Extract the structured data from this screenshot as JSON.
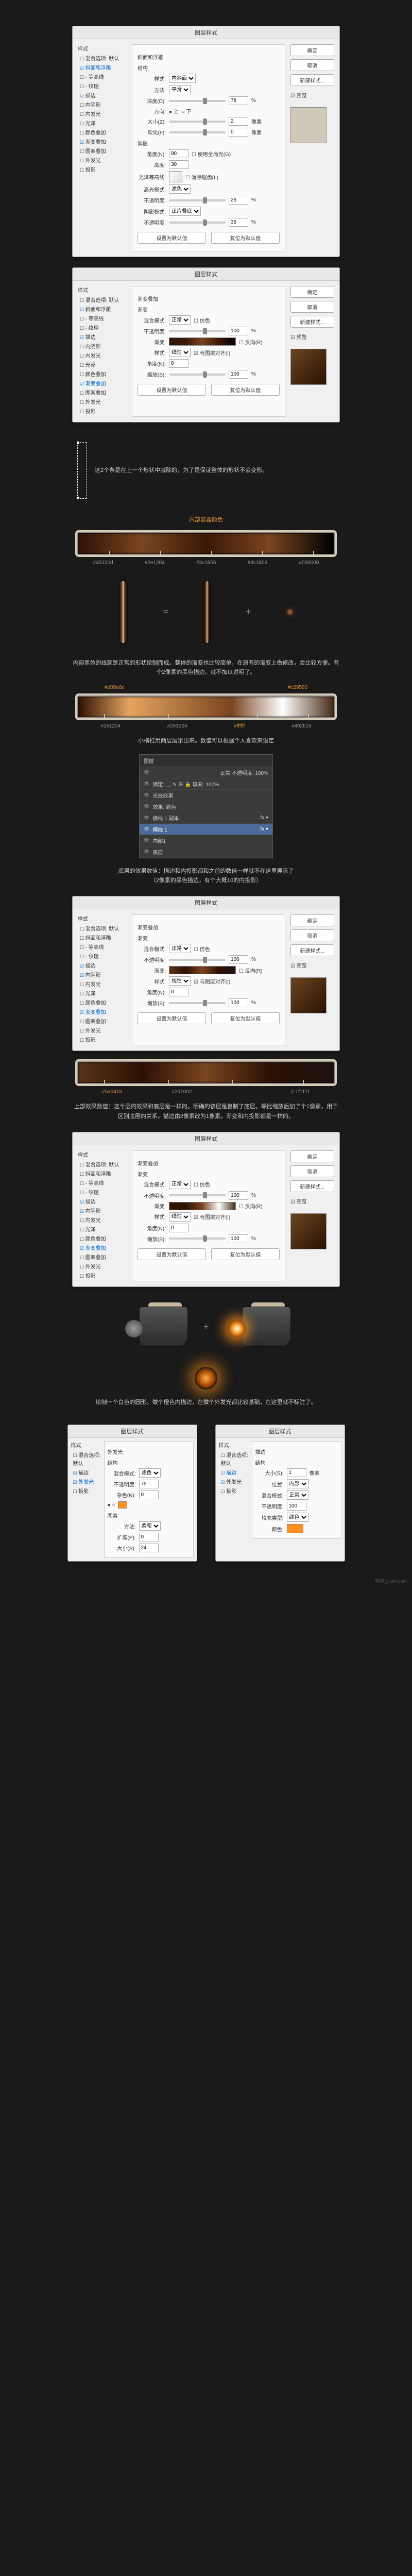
{
  "dialog_title": "图层样式",
  "styles": {
    "header": "样式",
    "blend_opts": "混合选项: 默认",
    "bevel": "斜面和浮雕",
    "contour": "- 等高线",
    "texture": "- 纹理",
    "stroke": "描边",
    "inner_shadow": "内阴影",
    "inner_glow": "内发光",
    "satin": "光泽",
    "color_overlay": "颜色叠加",
    "gradient_overlay": "渐变叠加",
    "pattern_overlay": "图案叠加",
    "outer_glow": "外发光",
    "drop_shadow": "投影"
  },
  "buttons": {
    "ok": "确定",
    "cancel": "取消",
    "new_style": "新建样式...",
    "preview": "☑ 预览",
    "make_default": "设置为默认值",
    "reset_default": "复位为默认值"
  },
  "bevel_panel": {
    "header": "斜面和浮雕",
    "sub1": "结构",
    "style_lbl": "样式:",
    "style_val": "内斜面",
    "method_lbl": "方法:",
    "method_val": "平滑",
    "depth_lbl": "深度(D):",
    "depth_val": "78",
    "pct": "%",
    "dir_lbl": "方向:",
    "dir_up": "● 上",
    "dir_down": "○ 下",
    "size_lbl": "大小(Z):",
    "size_val": "2",
    "px": "像素",
    "soft_lbl": "软化(F):",
    "soft_val": "0",
    "sub2": "阴影",
    "angle_lbl": "角度(N):",
    "angle_val": "90",
    "global_light": "☐ 使用全局光(G)",
    "alt_lbl": "高度:",
    "alt_val": "30",
    "gloss_lbl": "光泽等高线:",
    "anti": "☐ 消除锯齿(L)",
    "hi_mode_lbl": "高光模式:",
    "hi_mode_val": "滤色",
    "hi_op_lbl": "不透明度:",
    "hi_op_val": "26",
    "sh_mode_lbl": "阴影模式:",
    "sh_mode_val": "正片叠底",
    "sh_op_lbl": "不透明度:",
    "sh_op_val": "36"
  },
  "grad_panel": {
    "header": "渐变叠加",
    "sub": "渐变",
    "mode_lbl": "混合模式:",
    "mode_val": "正常",
    "dither": "☐ 仿色",
    "op_lbl": "不透明度:",
    "op_val": "100",
    "grad_lbl": "渐变:",
    "reverse": "☐ 反向(R)",
    "style_lbl": "样式:",
    "style_val": "线性",
    "align": "☑ 与图层对齐(I)",
    "angle_lbl": "角度(N):",
    "angle_val": "0",
    "scale_lbl": "缩放(S):",
    "scale_val": "100"
  },
  "note1": "这2个条是在上一个形状中减除的，为了是保证整体的形状不会变形。",
  "bar1_title": "内部容器颜色",
  "bar1_colors": [
    "#45120d",
    "#2e1204",
    "#3c1806",
    "#3c1806",
    "#000000"
  ],
  "note2": "内部黑色的线就是正常的形状绘制而成。整体的渐变也比较简单，在原有的渐变上做修改，会比较方便。有个2像素的黑色描边。就不加以说明了。",
  "bar2_colors_top": [
    "#d89a6c",
    "#c29580"
  ],
  "bar2_colors": [
    "#2e1204",
    "#2e1204",
    "#ffffff",
    "#492b16"
  ],
  "note3": "小横杠用两层展示出来。数值可以根据个人喜欢来设定",
  "layers": {
    "title": "图层",
    "tabs": "正常          不透明度: 100%",
    "lock": "锁定: ⬚ ✎ ⊕ 🔒     填充: 100%",
    "items": [
      "光线效果",
      "效果: 颜色",
      "横线 1 副本",
      "横线 1",
      "内部1",
      "底层"
    ],
    "fx": "fx ▾"
  },
  "note4": "底层的效果数值：描边和内投影都和之前的数值一样就不在这里展示了\n（2像素的黑色描边，有个大概10的内投影）",
  "bar3_colors": [
    "#5a3418",
    "#2d1002",
    "",
    "# 1f1111"
  ],
  "note5": "上部效果数值：这个层的效果和底层是一样的。明确的该层是复制了底层。等比缩放后加了个1像素，用于区别底层的关系。描边由2像素改为1像素。渐变和内投影都是一样的。",
  "note6": "绘制一个白色的圆形，做个橙色内描边，在做个外发光都比较基础，在这里就不标注了。",
  "outer_glow_panel": {
    "header": "外发光",
    "sub": "结构",
    "mode_lbl": "混合模式:",
    "mode_val": "滤色",
    "op_lbl": "不透明度:",
    "op_val": "75",
    "noise_lbl": "杂色(N):",
    "noise_val": "0",
    "color_row": "● ○",
    "sub2": "图素",
    "method_lbl": "方法:",
    "method_val": "柔和",
    "spread_lbl": "扩展(P):",
    "spread_val": "0",
    "size_lbl": "大小(S):",
    "size_val": "24"
  },
  "stroke_panel": {
    "header": "描边",
    "sub": "结构",
    "size_lbl": "大小(S):",
    "size_val": "1",
    "px": "像素",
    "pos_lbl": "位置:",
    "pos_val": "内部",
    "mode_lbl": "混合模式:",
    "mode_val": "正常",
    "op_lbl": "不透明度:",
    "op_val": "100",
    "fill_lbl": "填充类型:",
    "fill_val": "颜色",
    "color_lbl": "颜色:"
  },
  "watermark": "学院 jy.xsh.com"
}
